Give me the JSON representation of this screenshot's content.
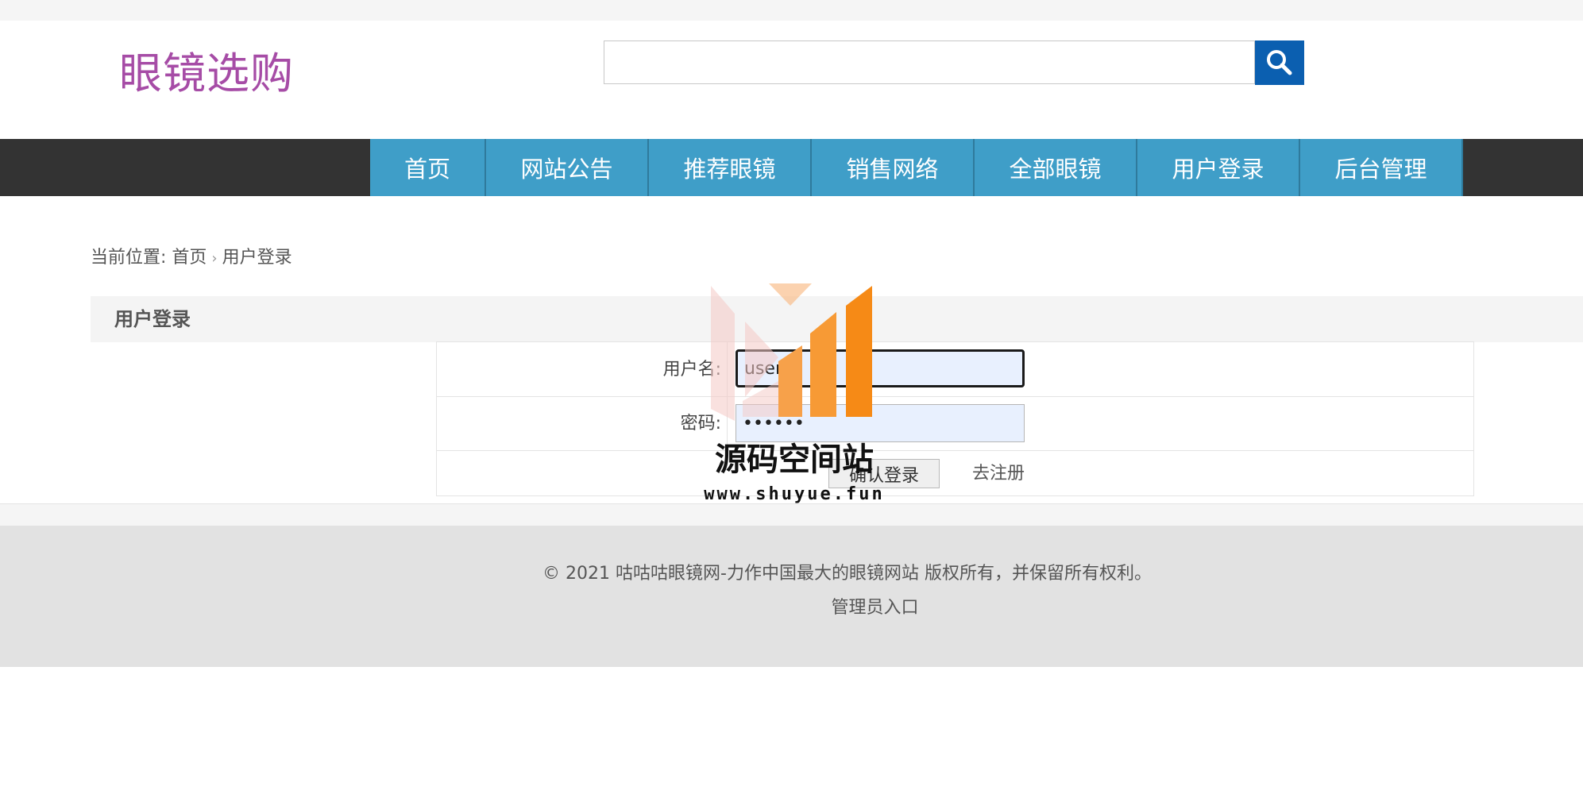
{
  "logo": {
    "text": "眼镜选购"
  },
  "search": {
    "value": "",
    "placeholder": "",
    "icon": "search-icon"
  },
  "nav": {
    "items": [
      {
        "label": "首页"
      },
      {
        "label": "网站公告"
      },
      {
        "label": "推荐眼镜"
      },
      {
        "label": "销售网络"
      },
      {
        "label": "全部眼镜"
      },
      {
        "label": "用户登录"
      },
      {
        "label": "后台管理"
      }
    ]
  },
  "breadcrumb": {
    "prefix": "当前位置: ",
    "home": "首页",
    "separator": "›",
    "current": "用户登录"
  },
  "login": {
    "title": "用户登录",
    "username_label": "用户名:",
    "username_value": "user",
    "password_label": "密码:",
    "password_value": "••••••",
    "submit_label": "确认登录",
    "register_label": "去注册"
  },
  "footer": {
    "copyright": "© 2021 咕咕咕眼镜网-力作中国最大的眼镜网站 版权所有，并保留所有权利。",
    "admin_link": "管理员入口"
  },
  "watermark": {
    "text": "源码空间站",
    "url": "www.shuyue.fun"
  },
  "colors": {
    "nav_bg": "#333333",
    "nav_item": "#3f9ec8",
    "search_button": "#0b5fb0",
    "logo": "#a64ca6",
    "footer_bg": "#e2e2e2",
    "field_bg": "#e8f0fe"
  }
}
